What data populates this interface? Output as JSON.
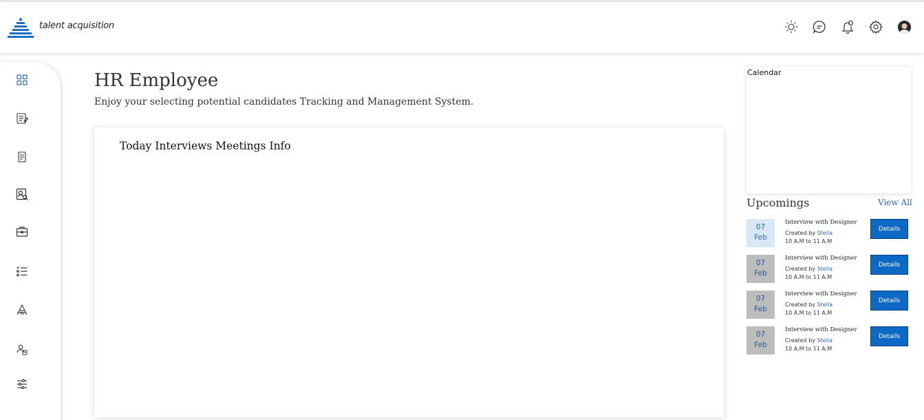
{
  "app": {
    "brand": "talent acquisition",
    "logo_icon": "pyramid-logo-icon",
    "accent": "#0c69c6"
  },
  "header": {
    "icons": [
      "sun-icon",
      "chat-icon",
      "bell-icon",
      "gear-icon",
      "avatar"
    ]
  },
  "sidebar": {
    "items": [
      {
        "icon": "dashboard-icon"
      },
      {
        "icon": "requisition-icon"
      },
      {
        "icon": "document-icon"
      },
      {
        "icon": "candidate-search-icon"
      },
      {
        "icon": "briefcase-icon"
      },
      {
        "icon": "checklist-icon"
      },
      {
        "icon": "interview-icon"
      },
      {
        "icon": "employee-icon"
      },
      {
        "icon": "settings-sliders-icon"
      }
    ]
  },
  "main": {
    "title": "HR Employee",
    "subtitle": "Enjoy your selecting potential candidates Tracking and Management System.",
    "card_title": "Today Interviews Meetings Info"
  },
  "right": {
    "calendar_label": "Calendar",
    "upcomings_title": "Upcomings",
    "view_all": "View All",
    "events": [
      {
        "day": "07",
        "month": "Feb",
        "title": "Interview with Designer",
        "created_prefix": "Created by",
        "created_by": "Stella",
        "time": "10 A.M to 11 A.M",
        "button": "Details",
        "state": "active"
      },
      {
        "day": "07",
        "month": "Feb",
        "title": "Interview with Designer",
        "created_prefix": "Created by",
        "created_by": "Stella",
        "time": "10 A.M to 11 A.M",
        "button": "Details",
        "state": "inactive"
      },
      {
        "day": "07",
        "month": "Feb",
        "title": "Interview with Designer",
        "created_prefix": "Created by",
        "created_by": "Stella",
        "time": "10 A.M to 11 A.M",
        "button": "Details",
        "state": "inactive"
      },
      {
        "day": "07",
        "month": "Feb",
        "title": "Interview with Designer",
        "created_prefix": "Created by",
        "created_by": "Stella",
        "time": "10 A.M to 11 A.M",
        "button": "Details",
        "state": "inactive"
      }
    ]
  }
}
